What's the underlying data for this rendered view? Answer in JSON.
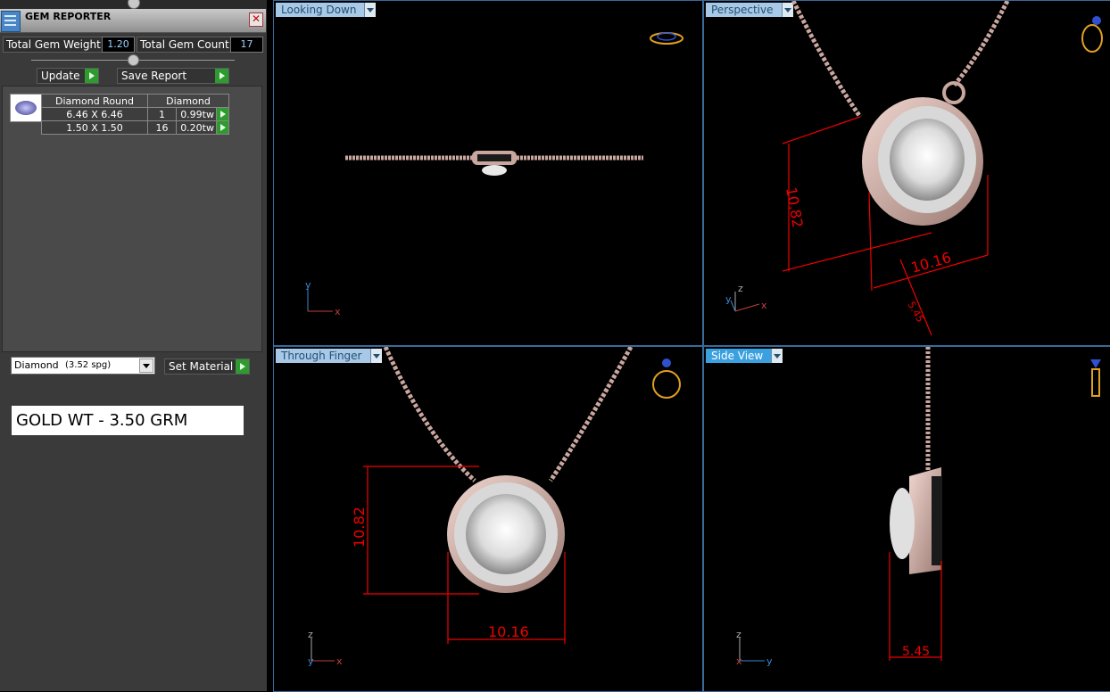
{
  "gem_reporter": {
    "title": "GEM REPORTER",
    "close_symbol": "✕",
    "total_weight_label": "Total Gem Weight",
    "total_weight_value": "1.20",
    "total_count_label": "Total Gem Count",
    "total_count_value": "17",
    "update_label": "Update",
    "save_report_label": "Save Report",
    "table_headers": [
      "Diamond Round",
      "Diamond"
    ],
    "rows": [
      {
        "size": "6.46 X 6.46",
        "count": "1",
        "weight": "0.99tw"
      },
      {
        "size": "1.50 X 1.50",
        "count": "16",
        "weight": "0.20tw"
      }
    ]
  },
  "material": {
    "name": "Diamond",
    "spg": "(3.52 spg)",
    "set_material_label": "Set Material"
  },
  "gold_weight_text": "GOLD WT - 3.50 GRM",
  "viewports": {
    "looking_down": {
      "label": "Looking Down",
      "axes": [
        "y",
        "x"
      ]
    },
    "perspective": {
      "label": "Perspective",
      "axes": [
        "z",
        "y",
        "x"
      ],
      "dims": [
        "10.82",
        "10.16",
        "5.45"
      ]
    },
    "through_finger": {
      "label": "Through Finger",
      "axes": [
        "z",
        "y",
        "x"
      ],
      "dims": [
        "10.82",
        "10.16"
      ]
    },
    "side_view": {
      "label": "Side View",
      "axes": [
        "z",
        "x",
        "y"
      ],
      "dims": [
        "5.45"
      ]
    }
  },
  "colors": {
    "accent_blue": "#3aa0e0",
    "dim_red": "#e00000",
    "metal": "#c9a79f",
    "go_green": "#2f9a2f"
  }
}
